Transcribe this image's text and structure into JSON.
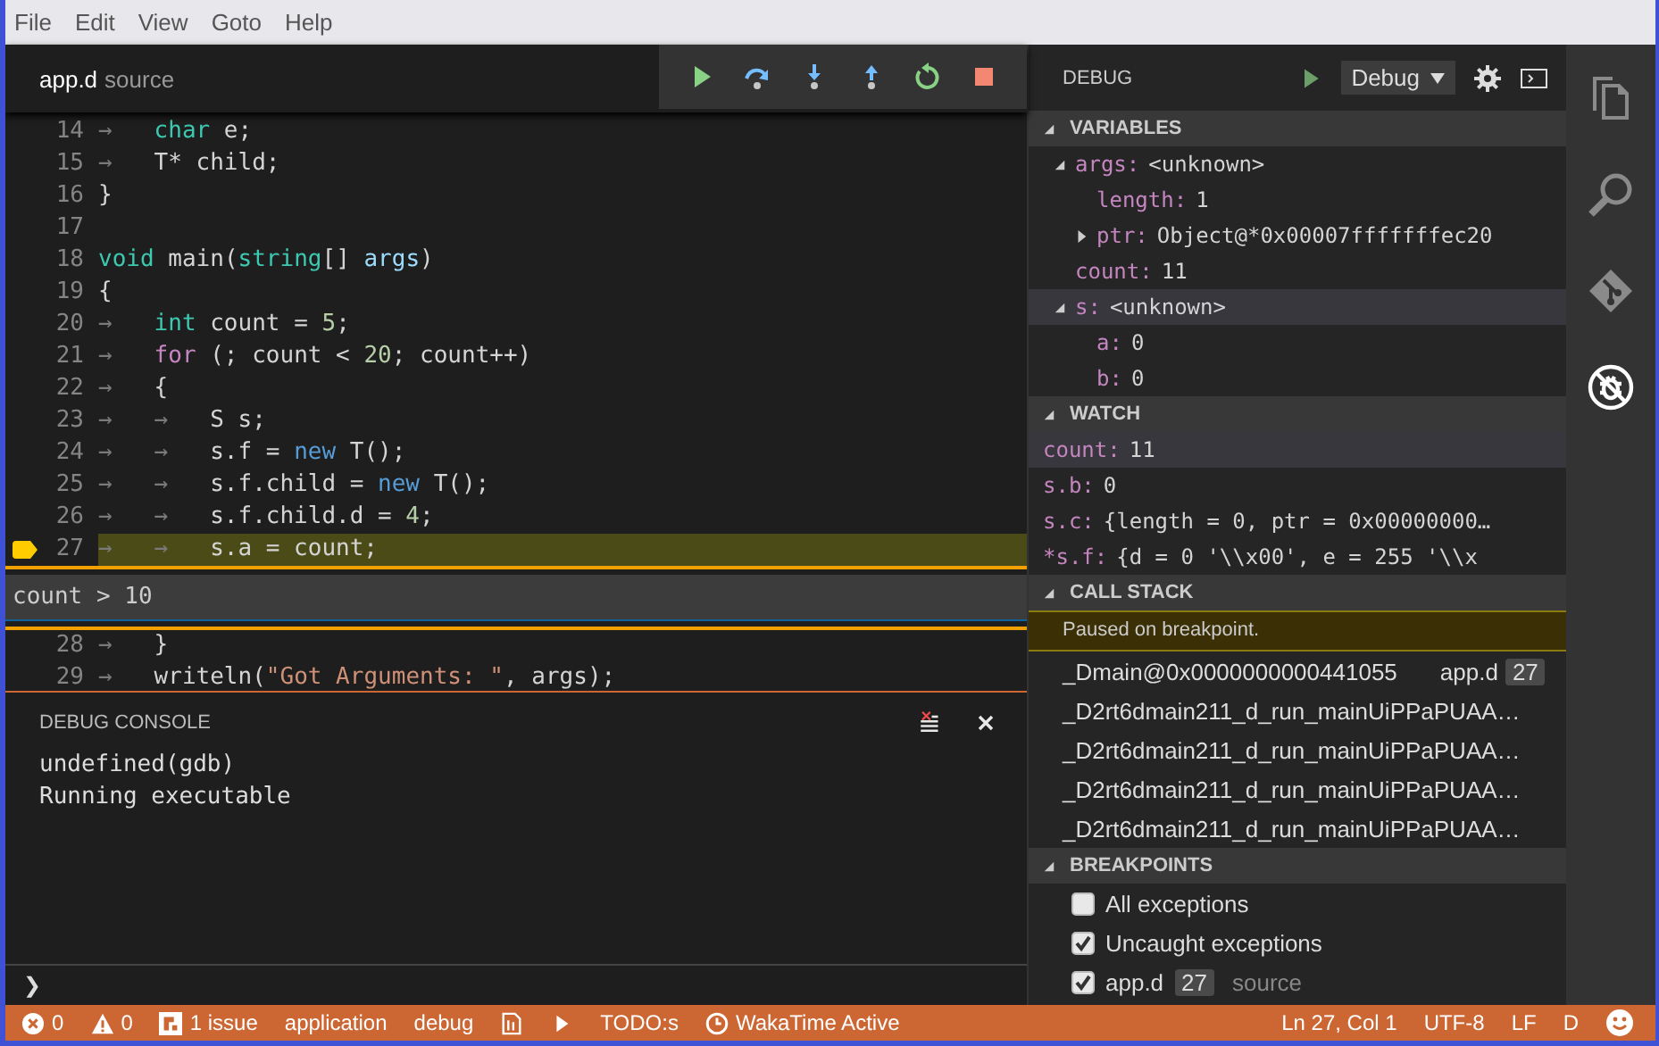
{
  "menu": [
    "File",
    "Edit",
    "View",
    "Goto",
    "Help"
  ],
  "editor": {
    "tab": {
      "name": "app.d",
      "detail": "source"
    },
    "debug_toolbar": [
      {
        "kind": "continue"
      },
      {
        "kind": "step-over"
      },
      {
        "kind": "step-into"
      },
      {
        "kind": "step-out"
      },
      {
        "kind": "restart"
      },
      {
        "kind": "stop"
      }
    ],
    "lines": [
      {
        "number": "14",
        "current": false,
        "breakpoint": false,
        "tokens": [
          {
            "kind": "tab",
            "text": "→"
          },
          {
            "kind": "type",
            "text": "char"
          },
          {
            "kind": "plain",
            "text": " e;"
          }
        ]
      },
      {
        "number": "15",
        "current": false,
        "breakpoint": false,
        "tokens": [
          {
            "kind": "tab",
            "text": "→"
          },
          {
            "kind": "plain",
            "text": "T* child;"
          }
        ]
      },
      {
        "number": "16",
        "current": false,
        "breakpoint": false,
        "tokens": [
          {
            "kind": "plain",
            "text": "}"
          }
        ]
      },
      {
        "number": "17",
        "current": false,
        "breakpoint": false
      },
      {
        "number": "18",
        "current": false,
        "breakpoint": false,
        "tokens": [
          {
            "kind": "type",
            "text": "void"
          },
          {
            "kind": "plain",
            "text": " main("
          },
          {
            "kind": "type",
            "text": "string"
          },
          {
            "kind": "plain",
            "text": "[] "
          },
          {
            "kind": "param",
            "text": "args"
          },
          {
            "kind": "plain",
            "text": ")"
          }
        ]
      },
      {
        "number": "19",
        "current": false,
        "breakpoint": false,
        "tokens": [
          {
            "kind": "plain",
            "text": "{"
          }
        ]
      },
      {
        "number": "20",
        "current": false,
        "breakpoint": false,
        "tokens": [
          {
            "kind": "tab",
            "text": "→"
          },
          {
            "kind": "type",
            "text": "int"
          },
          {
            "kind": "plain",
            "text": " count = "
          },
          {
            "kind": "number",
            "text": "5"
          },
          {
            "kind": "plain",
            "text": ";"
          }
        ]
      },
      {
        "number": "21",
        "current": false,
        "breakpoint": false,
        "tokens": [
          {
            "kind": "tab",
            "text": "→"
          },
          {
            "kind": "keyword",
            "text": "for"
          },
          {
            "kind": "plain",
            "text": " (; count < "
          },
          {
            "kind": "number",
            "text": "20"
          },
          {
            "kind": "plain",
            "text": "; count++)"
          }
        ]
      },
      {
        "number": "22",
        "current": false,
        "breakpoint": false,
        "tokens": [
          {
            "kind": "tab",
            "text": "→"
          },
          {
            "kind": "plain",
            "text": "{"
          }
        ]
      },
      {
        "number": "23",
        "current": false,
        "breakpoint": false,
        "tokens": [
          {
            "kind": "tab",
            "text": "→"
          },
          {
            "kind": "tab",
            "text": "→"
          },
          {
            "kind": "plain",
            "text": "S s;"
          }
        ]
      },
      {
        "number": "24",
        "current": false,
        "breakpoint": false,
        "tokens": [
          {
            "kind": "tab",
            "text": "→"
          },
          {
            "kind": "tab",
            "text": "→"
          },
          {
            "kind": "plain",
            "text": "s.f = "
          },
          {
            "kind": "new",
            "text": "new"
          },
          {
            "kind": "plain",
            "text": " T();"
          }
        ]
      },
      {
        "number": "25",
        "current": false,
        "breakpoint": false,
        "tokens": [
          {
            "kind": "tab",
            "text": "→"
          },
          {
            "kind": "tab",
            "text": "→"
          },
          {
            "kind": "plain",
            "text": "s.f.child = "
          },
          {
            "kind": "new",
            "text": "new"
          },
          {
            "kind": "plain",
            "text": " T();"
          }
        ]
      },
      {
        "number": "26",
        "current": false,
        "breakpoint": false,
        "tokens": [
          {
            "kind": "tab",
            "text": "→"
          },
          {
            "kind": "tab",
            "text": "→"
          },
          {
            "kind": "plain",
            "text": "s.f.child.d = "
          },
          {
            "kind": "number",
            "text": "4"
          },
          {
            "kind": "plain",
            "text": ";"
          }
        ]
      },
      {
        "number": "27",
        "current": true,
        "breakpoint": true,
        "condition": "count > 10",
        "tokens": [
          {
            "kind": "tab",
            "text": "→"
          },
          {
            "kind": "tab",
            "text": "→"
          },
          {
            "kind": "plain",
            "text": "s.a = count;"
          }
        ]
      },
      {
        "number": "28",
        "current": false,
        "breakpoint": false,
        "tokens": [
          {
            "kind": "tab",
            "text": "→"
          },
          {
            "kind": "plain",
            "text": "}"
          }
        ]
      },
      {
        "number": "29",
        "current": false,
        "breakpoint": false,
        "tokens": [
          {
            "kind": "tab",
            "text": "→"
          },
          {
            "kind": "plain",
            "text": "writeln("
          },
          {
            "kind": "string",
            "text": "\"Got Arguments: \""
          },
          {
            "kind": "plain",
            "text": ", args);"
          }
        ]
      }
    ]
  },
  "debug_console": {
    "title": "DEBUG CONSOLE",
    "output": [
      "undefined(gdb)",
      "Running executable"
    ],
    "prompt": "❯"
  },
  "debug_panel": {
    "title": "DEBUG",
    "configuration": "Debug",
    "sections": [
      {
        "kind": "variables",
        "title": "VARIABLES",
        "expanded": true,
        "items": [
          {
            "name": "args:",
            "value": "<unknown>",
            "expanded": true,
            "selected": false,
            "children": [
              {
                "name": "length:",
                "value": "1",
                "selected": false
              },
              {
                "name": "ptr:",
                "value": "Object@*0x00007fffffffec20",
                "expanded": false,
                "selected": false
              }
            ]
          },
          {
            "name": "count:",
            "value": "11",
            "selected": false
          },
          {
            "name": "s:",
            "value": "<unknown>",
            "expanded": true,
            "selected": true,
            "children": [
              {
                "name": "a:",
                "value": "0",
                "selected": false
              },
              {
                "name": "b:",
                "value": "0",
                "selected": false
              }
            ]
          }
        ]
      },
      {
        "kind": "watch",
        "title": "WATCH",
        "expanded": true,
        "items": [
          {
            "name": "count:",
            "value": "11",
            "selected": true
          },
          {
            "name": "s.b:",
            "value": "0",
            "selected": false
          },
          {
            "name": "s.c:",
            "value": "{length = 0, ptr = 0x00000000…",
            "selected": false
          },
          {
            "name": "*s.f:",
            "value": "{d = 0 '\\\\x00', e = 255 '\\\\x",
            "selected": false
          }
        ]
      },
      {
        "kind": "call_stack",
        "title": "CALL STACK",
        "expanded": true,
        "notice": "Paused on breakpoint.",
        "frames": [
          {
            "function": "_Dmain@0x0000000000441055",
            "file": "app.d",
            "line": "27"
          },
          {
            "function": "_D2rt6dmain211_d_run_mainUiPPaPUAA…"
          },
          {
            "function": "_D2rt6dmain211_d_run_mainUiPPaPUAA…"
          },
          {
            "function": "_D2rt6dmain211_d_run_mainUiPPaPUAA…"
          },
          {
            "function": "_D2rt6dmain211_d_run_mainUiPPaPUAA…"
          }
        ]
      },
      {
        "kind": "breakpoints",
        "title": "BREAKPOINTS",
        "expanded": true,
        "items": [
          {
            "label": "All exceptions",
            "checked": false
          },
          {
            "label": "Uncaught exceptions",
            "checked": true
          },
          {
            "label": "app.d",
            "line": "27",
            "detail": "source",
            "checked": true
          }
        ]
      }
    ]
  },
  "activity_bar": [
    {
      "kind": "files",
      "selected": false
    },
    {
      "kind": "search",
      "selected": false
    },
    {
      "kind": "git",
      "selected": false
    },
    {
      "kind": "debug",
      "selected": true
    }
  ],
  "status_bar": {
    "left": [
      {
        "kind": "errors",
        "text": "0"
      },
      {
        "kind": "warnings",
        "text": "0"
      },
      {
        "kind": "issues",
        "text": "1 issue"
      },
      {
        "kind": "text",
        "text": "application"
      },
      {
        "kind": "text",
        "text": "debug"
      },
      {
        "kind": "file"
      },
      {
        "kind": "run"
      },
      {
        "kind": "text",
        "text": "TODO:s"
      },
      {
        "kind": "wakatime",
        "text": "WakaTime Active"
      }
    ],
    "right": [
      {
        "kind": "text",
        "text": "Ln 27, Col 1"
      },
      {
        "kind": "text",
        "text": "UTF-8"
      },
      {
        "kind": "text",
        "text": "LF"
      },
      {
        "kind": "text",
        "text": "D"
      },
      {
        "kind": "smiley"
      }
    ]
  }
}
